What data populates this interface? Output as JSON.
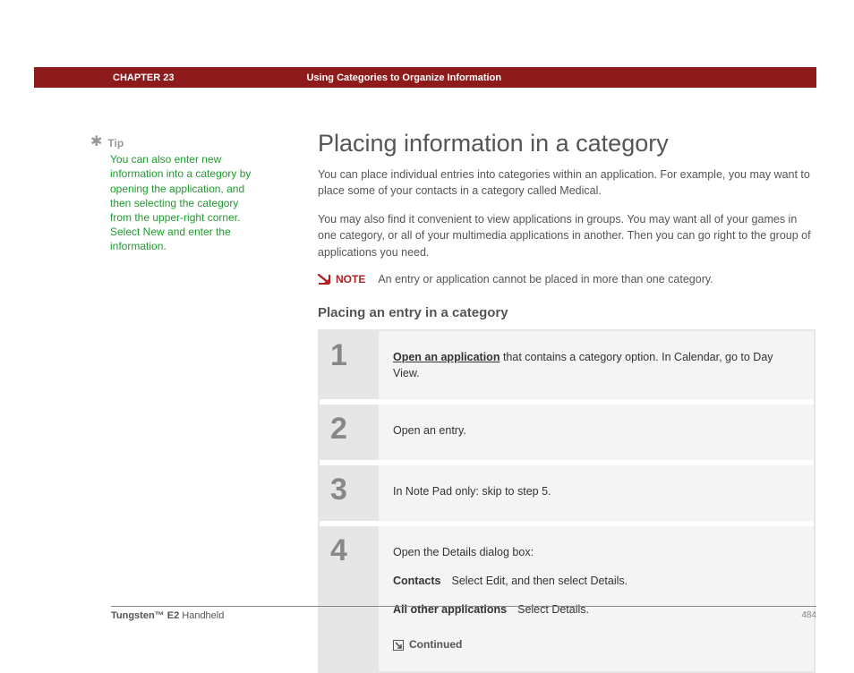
{
  "header": {
    "chapter_label": "CHAPTER 23",
    "chapter_title": "Using Categories to Organize Information"
  },
  "tip": {
    "label": "Tip",
    "body": "You can also enter new information into a category by opening the application, and then selecting the category from the upper-right corner. Select New and enter the information."
  },
  "main": {
    "h1": "Placing information in a category",
    "p1": "You can place individual entries into categories within an application. For example, you may want to place some of your contacts in a category called Medical.",
    "p2": "You may also find it convenient to view applications in groups. You may want all of your games in one category, or all of your multimedia applications in another. Then you can go right to the group of applications you need.",
    "note_label": "NOTE",
    "note_text": "An entry or application cannot be placed in more than one category.",
    "h2": "Placing an entry in a category",
    "steps": [
      {
        "num": "1",
        "link": "Open an application",
        "rest": " that contains a category option. In Calendar, go to Day View."
      },
      {
        "num": "2",
        "text": "Open an entry."
      },
      {
        "num": "3",
        "text": "In Note Pad only: skip to step 5."
      },
      {
        "num": "4",
        "intro": "Open the Details dialog box:",
        "rows": [
          {
            "label": "Contacts",
            "text": "Select Edit, and then select Details."
          },
          {
            "label": "All other applications",
            "text": "Select Details."
          }
        ],
        "continued": "Continued"
      }
    ]
  },
  "footer": {
    "product_bold": "Tungsten™ E2",
    "product_rest": " Handheld",
    "page_num": "484"
  }
}
